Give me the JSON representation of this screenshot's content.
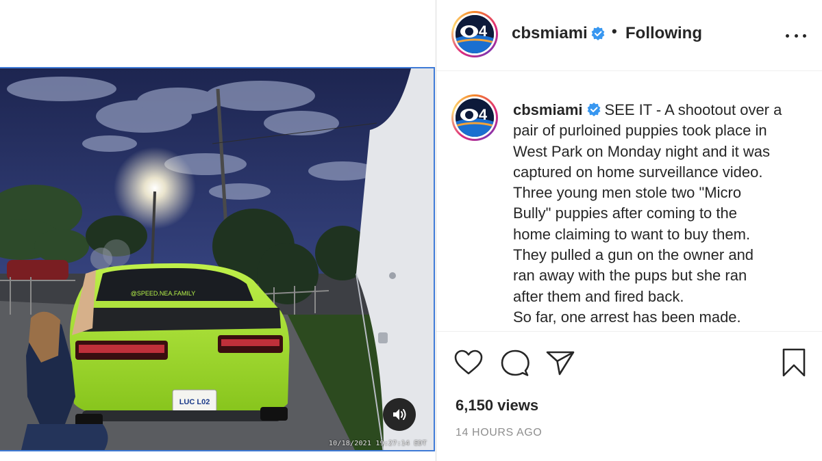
{
  "header": {
    "username": "cbsmiami",
    "separator": "•",
    "follow_status": "Following",
    "avatar_logo_text": "4"
  },
  "caption": {
    "username": "cbsmiami",
    "lines": [
      "SEE IT - A shootout over a",
      "pair of purloined puppies took place in",
      "West Park on Monday night and it was",
      "captured on home surveillance video.",
      "Three young men stole two \"Micro",
      "Bully\" puppies after coming to the",
      "home claiming to want to buy them.",
      "They pulled a gun on the owner and",
      "ran away with the pups but she ran",
      "after them and fired back.",
      "So far, one arrest has been made."
    ]
  },
  "video": {
    "timestamp": "10/18/2021 19:27:14 EDT",
    "license_plate": "LUC L02",
    "rear_window_text": "@SPEED.NEA.FAMILY"
  },
  "stats": {
    "views": "6,150 views",
    "time_ago": "14 HOURS AGO"
  },
  "icons": {
    "like": "heart-icon",
    "comment": "comment-icon",
    "share": "paper-plane-icon",
    "save": "bookmark-icon",
    "more": "more-options-icon",
    "sound": "speaker-icon",
    "verified": "verified-badge-icon"
  },
  "colors": {
    "verified_blue": "#3897f0",
    "text_primary": "#262626",
    "text_secondary": "#8e8e8e",
    "car_green": "#a6e02a",
    "video_border": "#3d7ad6"
  }
}
